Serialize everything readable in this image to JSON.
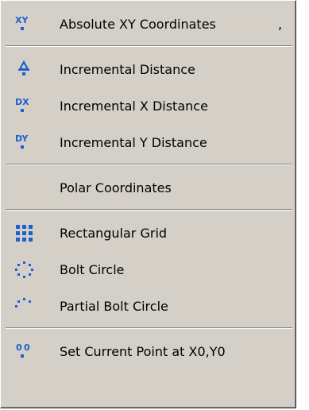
{
  "menu": {
    "accent_color": "#1f5fcf",
    "items": [
      {
        "label": "Absolute XY Coordinates",
        "shortcut": ",",
        "icon": "xy-icon"
      },
      {
        "label": "Incremental Distance",
        "icon": "delta-icon"
      },
      {
        "label": "Incremental X Distance",
        "icon": "dx-icon"
      },
      {
        "label": "Incremental Y Distance",
        "icon": "dy-icon"
      },
      {
        "label": "Polar Coordinates",
        "icon": ""
      },
      {
        "label": "Rectangular Grid",
        "icon": "rectangular-grid-icon"
      },
      {
        "label": "Bolt Circle",
        "icon": "bolt-circle-icon"
      },
      {
        "label": "Partial Bolt Circle",
        "icon": "partial-bolt-circle-icon"
      },
      {
        "label": "Set Current Point at X0,Y0",
        "icon": "origin-icon"
      }
    ]
  },
  "icon_glyphs": {
    "xy": "XY",
    "dx": "DX",
    "dy": "DY",
    "origin": "0,0"
  }
}
